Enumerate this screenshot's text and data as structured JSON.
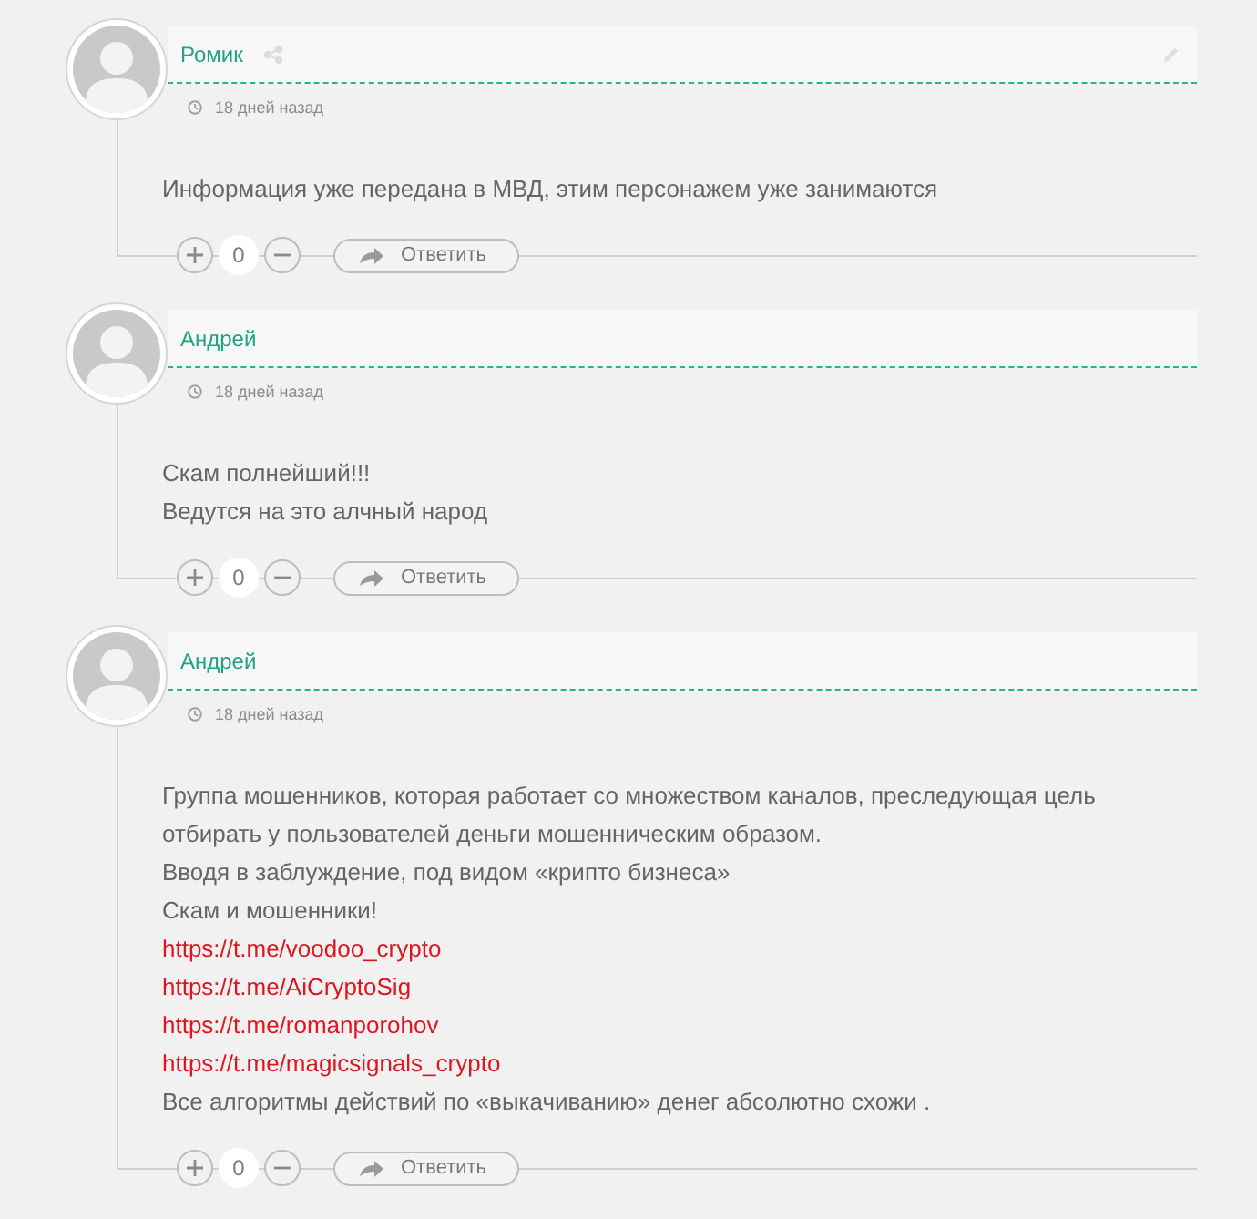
{
  "comments": [
    {
      "author": "Ромик",
      "can_share": true,
      "can_edit": true,
      "time": "18 дней назад",
      "lines": [
        {
          "kind": "text",
          "text": "Информация уже передана в МВД, этим персонажем уже занимаются"
        }
      ],
      "score": "0",
      "reply_label": "Ответить"
    },
    {
      "author": "Андрей",
      "can_share": false,
      "can_edit": false,
      "time": "18 дней назад",
      "lines": [
        {
          "kind": "text",
          "text": "Скам полнейший!!!"
        },
        {
          "kind": "text",
          "text": "Ведутся на это алчный народ"
        }
      ],
      "score": "0",
      "reply_label": "Ответить"
    },
    {
      "author": "Андрей",
      "can_share": false,
      "can_edit": false,
      "time": "18 дней назад",
      "lines": [
        {
          "kind": "text",
          "text": "Группа мошенников, которая работает со множеством каналов, преследующая цель отбирать у пользователей деньги мошенническим образом."
        },
        {
          "kind": "text",
          "text": "Вводя в заблуждение, под видом «крипто бизнеса»"
        },
        {
          "kind": "text",
          "text": "Скам и мошенники!"
        },
        {
          "kind": "link",
          "text": "https://t.me/voodoo_crypto"
        },
        {
          "kind": "link",
          "text": "https://t.me/AiCryptoSig"
        },
        {
          "kind": "link",
          "text": "https://t.me/romanporohov"
        },
        {
          "kind": "link",
          "text": "https://t.me/magicsignals_crypto"
        },
        {
          "kind": "text",
          "text": "Все алгоритмы действий по «выкачиванию» денег абсолютно схожи ."
        }
      ],
      "score": "0",
      "reply_label": "Ответить"
    }
  ]
}
